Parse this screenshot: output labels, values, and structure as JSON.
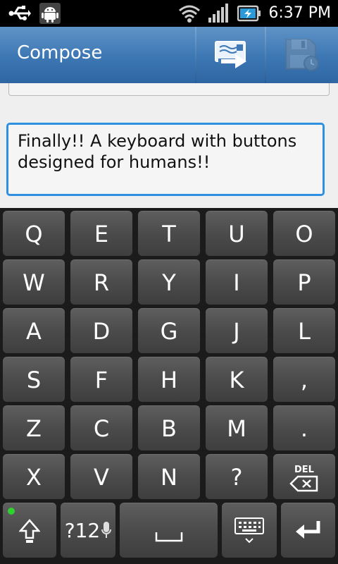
{
  "status_bar": {
    "time": "6:37 PM",
    "icons": [
      "usb-icon",
      "android-debug-icon",
      "wifi-icon",
      "signal-icon",
      "battery-charging-icon"
    ]
  },
  "action_bar": {
    "title": "Compose",
    "actions": [
      "send-icon",
      "save-draft-icon"
    ]
  },
  "compose": {
    "message": "Finally!! A keyboard with buttons designed for humans!!"
  },
  "keyboard": {
    "rows": [
      [
        "Q",
        "E",
        "T",
        "U",
        "O"
      ],
      [
        "W",
        "R",
        "Y",
        "I",
        "P"
      ],
      [
        "A",
        "D",
        "G",
        "J",
        "L"
      ],
      [
        "S",
        "F",
        "H",
        "K",
        ","
      ],
      [
        "Z",
        "C",
        "B",
        "M",
        "."
      ],
      [
        "X",
        "V",
        "N",
        "?",
        ""
      ]
    ],
    "del_label": "DEL",
    "symbols_label": "?12",
    "colors": {
      "accent": "#2f8fe0",
      "action_bar": "#3f79b5",
      "shift_indicator": "#2ed12e"
    }
  }
}
